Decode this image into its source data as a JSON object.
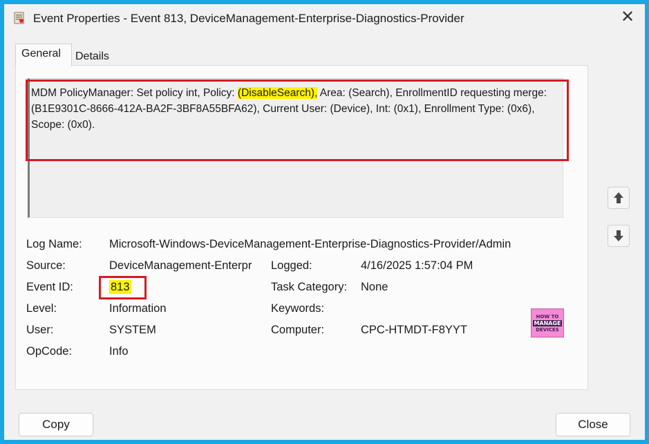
{
  "window": {
    "title": "Event Properties - Event 813, DeviceManagement-Enterprise-Diagnostics-Provider",
    "close_glyph": "✕"
  },
  "tabs": [
    {
      "label": "General",
      "active": true
    },
    {
      "label": "Details",
      "active": false
    }
  ],
  "description": {
    "part1": "MDM PolicyManager: Set policy int, Policy: ",
    "highlight": "(DisableSearch),",
    "part2": " Area: (Search), EnrollmentID requesting merge: (B1E9301C-8666-412A-BA2F-3BF8A55BFA62), Current User: (Device), Int: (0x1), Enrollment Type: (0x6), Scope: (0x0)."
  },
  "fields": {
    "log_name": {
      "label": "Log Name:",
      "value": "Microsoft-Windows-DeviceManagement-Enterprise-Diagnostics-Provider/Admin"
    },
    "source": {
      "label": "Source:",
      "value": "DeviceManagement-Enterpr"
    },
    "logged": {
      "label": "Logged:",
      "value": "4/16/2025 1:57:04 PM"
    },
    "event_id": {
      "label": "Event ID:",
      "value": "813"
    },
    "task_category": {
      "label": "Task Category:",
      "value": "None"
    },
    "level": {
      "label": "Level:",
      "value": "Information"
    },
    "keywords": {
      "label": "Keywords:",
      "value": ""
    },
    "user": {
      "label": "User:",
      "value": "SYSTEM"
    },
    "computer": {
      "label": "Computer:",
      "value": "CPC-HTMDT-F8YYT"
    },
    "opcode": {
      "label": "OpCode:",
      "value": "Info"
    }
  },
  "logo": {
    "line1": "HOW TO",
    "line2": "MANAGE",
    "line3": "DEVICES"
  },
  "buttons": {
    "copy": "Copy",
    "close": "Close"
  },
  "icons": {
    "title": "event-viewer-icon",
    "up": "arrow-up-icon",
    "down": "arrow-down-icon"
  },
  "colors": {
    "background": "#18a8e6",
    "annotation_red": "#d41c24",
    "highlight": "#fff200"
  }
}
